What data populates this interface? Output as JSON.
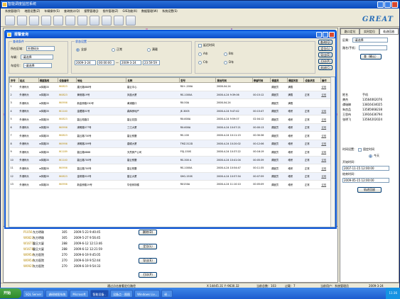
{
  "app": {
    "title": "智能调度监控系统",
    "logo": "GREAT"
  },
  "menu": [
    "系统管理(F)",
    "地图设置(Z)",
    "车辆操作(S)",
    "查询统计(Q)",
    "报警管理(J)",
    "指令管理(Z)",
    "GIS功能(K)",
    "数据管理(W)",
    "系统设置(S)"
  ],
  "toolbar_icons": [
    "gear-icon",
    "zoom-in-icon",
    "zoom-out-icon",
    "zoom-reset-icon",
    "pan-icon",
    "globe-icon",
    "arrow-left-icon",
    "arrow-right-icon",
    "measure-icon",
    "key-icon",
    "flag-icon"
  ],
  "dialog": {
    "title": "报警查询",
    "query_group": "查询条件",
    "area_label": "所在区域：",
    "area_value": "外港码头",
    "vehicle_label": "车辆：",
    "vehicle_value": "-请选择",
    "group_label": "车组号：",
    "group_value": "-请选择",
    "status_group": "状态设置",
    "status_all": "全部",
    "status_normal": "正常",
    "status_fault": "满载",
    "date_from": "2009-3-24",
    "time_from": "00:00:00",
    "date_to": "2009-3-24",
    "time_to": "23:59:59",
    "time_label": "延迟时间",
    "opt_a": "A车",
    "opt_b": "B车",
    "opt_c": "C车",
    "opt_d": "D车",
    "btn_query": "查询(Q)",
    "btn_locate": "定位(L)",
    "btn_export": "导出(E)",
    "btn_print": "打印(P)",
    "btn_close": "关闭(C)"
  },
  "table": {
    "headers": [
      "序号",
      "站点",
      "调度路线",
      "设备编号",
      "地址",
      "名称",
      "型号",
      "报出时间",
      "停留时间",
      "调度员",
      "调度状态",
      "设备状态",
      "操作"
    ],
    "rows": [
      [
        "1",
        "外港码头",
        "w择路35",
        "W0823",
        "建元路888号",
        "碧云中心",
        "RX+-200A",
        "2008-04-24",
        "",
        "调度员",
        "满载",
        "",
        "说明"
      ],
      [
        "2",
        "外港码头",
        "w择路35",
        "W0823",
        "黄杨路19号",
        "凤凰大厦",
        "RS-1000A",
        "2008-4-24 9:39:06",
        "00:15:12",
        "调度员",
        "满载",
        "正常",
        "说明"
      ],
      [
        "3",
        "外港码头",
        "w择路35",
        "W0956",
        "新金桥路230号",
        "黄浦路口",
        "RX-50A",
        "2008-04-24",
        "",
        "调度员",
        "满载",
        "",
        ""
      ],
      [
        "4",
        "外港码头",
        "w择路35",
        "W1140",
        "金藏路51号",
        "森辉房地产",
        "JE-3005",
        "2008-4-24 9:47:42",
        "00:15:47",
        "调度员",
        "堆积",
        "正常",
        "说明"
      ],
      [
        "5",
        "外港码头",
        "w择路35",
        "W0823",
        "碧云苑路口",
        "碧云花园",
        "RX-600A",
        "2008-4-24 9:59:07",
        "02:04:12",
        "调度员",
        "堆积",
        "正常",
        "说明"
      ],
      [
        "6",
        "外港码头",
        "w择路35",
        "W0956",
        "浦明路577号",
        "三江大厦",
        "RX-600A",
        "2008-4-24 10:07:21",
        "00:00:13",
        "调度员",
        "堆积",
        "正常",
        "说明"
      ],
      [
        "7",
        "外港码头",
        "w择路35",
        "W0823",
        "碧云路730号",
        "碧云别墅",
        "RS-100",
        "2008-4-24 10:11:15",
        "00:30:36",
        "调度员",
        "堆积",
        "正常",
        "说明"
      ],
      [
        "8",
        "外港码头",
        "w择路35",
        "W0956",
        "浦明路209号",
        "建候大厦",
        "TMZ-312D",
        "2008-4-24 10:20:02",
        "00:12:06",
        "调度员",
        "堆积",
        "正常",
        "说明"
      ],
      [
        "9",
        "外港码头",
        "w择路35",
        "W1189",
        "碧云路6888",
        "天然房产公司",
        "FGJ-150S",
        "2008-4-24 10:37:22",
        "00:16:19",
        "调度员",
        "堆积",
        "正常",
        "说明"
      ],
      [
        "10",
        "外港码头",
        "w择路35",
        "W1140",
        "碧云路700号",
        "碧云别墅",
        "RS-300 A",
        "2008-4-24 10:41:04",
        "00:05:39",
        "调度员",
        "堆积",
        "正常",
        "说明"
      ],
      [
        "11",
        "外港码头",
        "w择路35",
        "W0956",
        "碧云路700号",
        "碧云别墅",
        "RS-1000A",
        "2008-4-24 10:54:47",
        "00:11:35",
        "调度员",
        "堆积",
        "正常",
        "说明"
      ],
      [
        "12",
        "外港码头",
        "w择路35",
        "W0823",
        "金桥路510号",
        "碧云大厦",
        "SHG-150S",
        "2008-4-24 10:57:54",
        "00:07:59",
        "调度员",
        "堆积",
        "正常",
        "说明"
      ],
      [
        "13",
        "外港码头",
        "w择路35",
        "W0956",
        "新金桥路19号",
        "华信商场楼",
        "RX150A",
        "2008-4-24 11:10:10",
        "00:05:09",
        "调度员",
        "堆积",
        "正常",
        "说明"
      ]
    ]
  },
  "lower_list": [
    [
      "P1056",
      "东方明珠",
      "305",
      "2009-5-23 9:40:45"
    ],
    [
      "W0823",
      "东方明珠",
      "305",
      "2009-5-27 9:56:45"
    ],
    [
      "W1677",
      "震旦大厦",
      "288",
      "2009-6-12 12:13:46"
    ],
    [
      "W1678",
      "震旦大厦",
      "288",
      "2009-6-12 12:21:59"
    ],
    [
      "W0954",
      "东方医院",
      "270",
      "2009-6-19 9:45:05"
    ],
    [
      "W0954",
      "东方医院",
      "270",
      "2009-6-19 9:52:44"
    ],
    [
      "W0925",
      "东方医院",
      "270",
      "2009-6-19 9:54:33"
    ]
  ],
  "lower_buttons": [
    "删除(D)",
    "定位(L)",
    "导出(E)",
    "打印(P)"
  ],
  "right_panel": {
    "tabs": [
      "路口定位",
      "实时定位",
      "轨迹回放"
    ],
    "area_label": "区属：",
    "area_value": "-请选择",
    "search_label": "路名/手机：",
    "search_btn": "查（确认）",
    "cols": [
      "姓名",
      "手机"
    ],
    "contacts": [
      [
        "龚杰",
        "13564062076"
      ],
      [
        "谭瑞琳",
        "13816434025"
      ],
      [
        "朱良品",
        "13585668238"
      ],
      [
        "王思伟",
        "13916436794"
      ],
      [
        "张明飞",
        "13564202024"
      ]
    ],
    "time_label": "时间设置：",
    "time_opt": "固定时间",
    "time_opt2": "今天",
    "start_label": "开始时间：",
    "start_value": "2007-11-15 12:00:00",
    "end_label": "结束时间：",
    "end_value": "2009-05-15 12:00:00",
    "replay_btn": "轨迹回放"
  },
  "status": {
    "center": "通过点击查看定位路径",
    "coords": "X:14445.31 Y:-9630.32",
    "total": "当前总数：103",
    "total2": "过载：7",
    "current": "当前用户：系统管理员",
    "date": "2009-3-24"
  },
  "taskbar": {
    "start": "开始",
    "items": [
      "SQL Server",
      "调研制图系统",
      "Microsoft",
      "智能设备..",
      "设备点 - 图图",
      "Windows Liv...",
      "研..."
    ],
    "clock": "11:36"
  }
}
